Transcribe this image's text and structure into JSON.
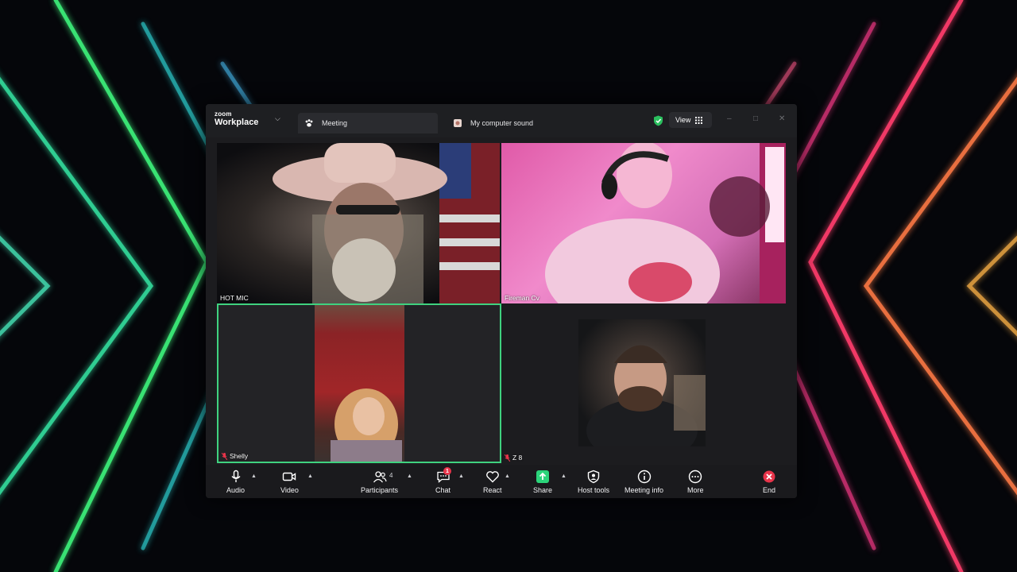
{
  "titlebar": {
    "brand_small": "zoom",
    "brand_large": "Workplace",
    "tabs": [
      {
        "label": "Meeting",
        "icon": "paw-icon"
      },
      {
        "label": "My computer sound",
        "icon": "computer-sound-icon"
      }
    ],
    "view_label": "View",
    "security_color": "#2bbf5e"
  },
  "participants": [
    {
      "name": "HOT MIC",
      "muted": false
    },
    {
      "name": "Fireman Cv",
      "muted": false
    },
    {
      "name": "Shelly",
      "muted": true,
      "active_speaker": true
    },
    {
      "name": "Z 8",
      "muted": true
    }
  ],
  "toolbar": {
    "audio": "Audio",
    "video": "Video",
    "participants": "Participants",
    "participants_count": "4",
    "chat": "Chat",
    "chat_badge": "1",
    "react": "React",
    "share": "Share",
    "host_tools": "Host tools",
    "meeting_info": "Meeting info",
    "more": "More",
    "end": "End"
  },
  "colors": {
    "active_speaker": "#3fd27f",
    "share": "#2bd47a",
    "end": "#e8344a"
  }
}
